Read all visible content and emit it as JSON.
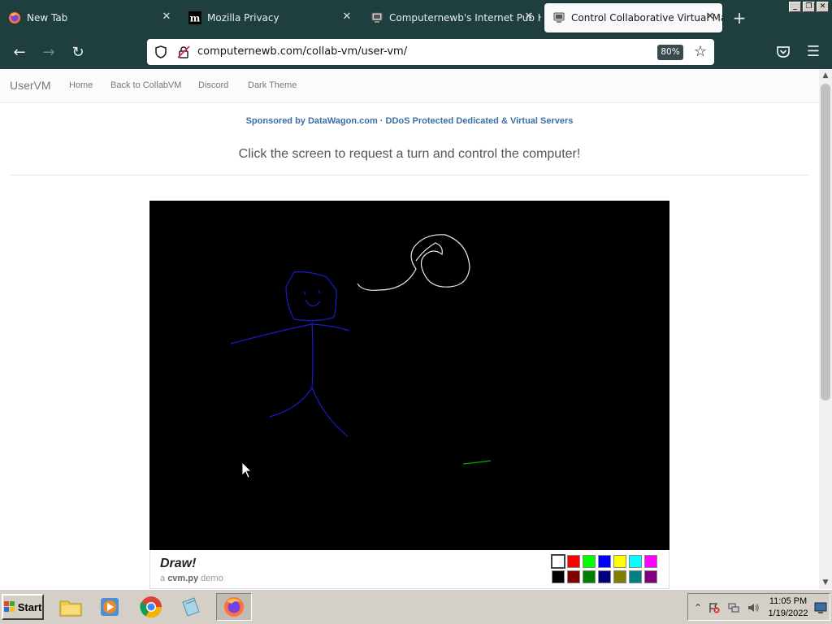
{
  "browser": {
    "tabs": [
      {
        "label": "New Tab",
        "icon": "firefox-icon"
      },
      {
        "label": "Mozilla Privacy",
        "icon": "mozilla-m-icon"
      },
      {
        "label": "Computernewb's Internet Pub Hub",
        "icon": "computernewb-icon"
      },
      {
        "label": "Control Collaborative Virtual Machine",
        "icon": "computernewb-icon"
      }
    ],
    "url": "computernewb.com/collab-vm/user-vm/",
    "zoom": "80%"
  },
  "site": {
    "brand": "UserVM",
    "nav": [
      "Home",
      "Back to CollabVM",
      "Discord",
      "Dark Theme"
    ],
    "sponsor": "Sponsored by DataWagon.com · DDoS Protected Dedicated & Virtual Servers",
    "instruction": "Click the screen to request a turn and control the computer!"
  },
  "vm": {
    "title": "Draw!",
    "subtitle_prefix": "a",
    "subtitle_app": "cvm.py",
    "subtitle_suffix": "demo",
    "palette_top": [
      "#ffffff",
      "#ff0000",
      "#00ff00",
      "#0000ff",
      "#ffff00",
      "#00ffff",
      "#ff00ff"
    ],
    "palette_bottom": [
      "#000000",
      "#800000",
      "#008000",
      "#000080",
      "#808000",
      "#008080",
      "#800080"
    ]
  },
  "taskbar": {
    "start_label": "Start",
    "time": "11:05 PM",
    "date": "1/19/2022"
  }
}
